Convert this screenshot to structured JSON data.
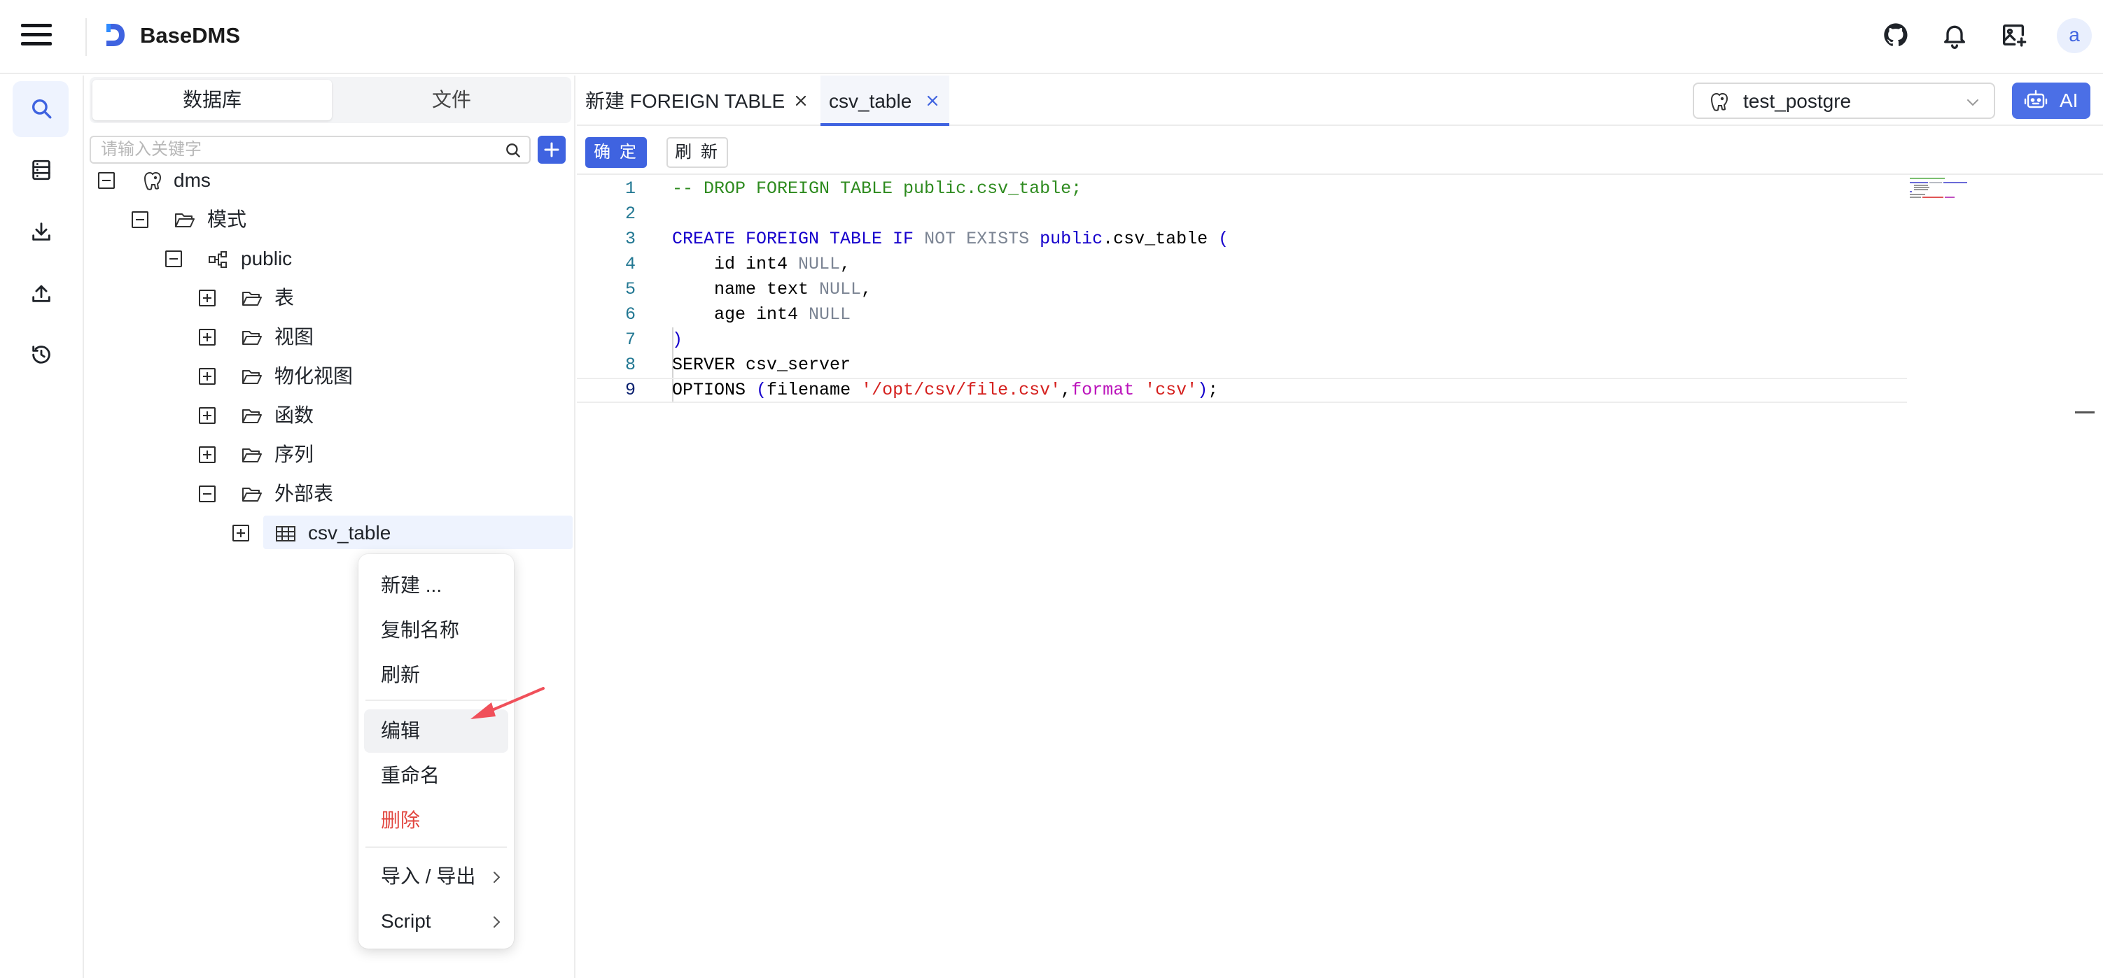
{
  "app": {
    "title": "BaseDMS",
    "avatar_letter": "a",
    "accent_color": "#3f63e0"
  },
  "topbar_icons": [
    "github-icon",
    "bell-icon",
    "image-plus-icon"
  ],
  "rail": [
    {
      "name": "search-icon",
      "active": true
    },
    {
      "name": "database-icon",
      "active": false
    },
    {
      "name": "download-icon",
      "active": false
    },
    {
      "name": "upload-icon",
      "active": false
    },
    {
      "name": "history-icon",
      "active": false
    }
  ],
  "explorer": {
    "tabs": [
      {
        "label": "数据库",
        "active": true
      },
      {
        "label": "文件",
        "active": false
      }
    ],
    "search_placeholder": "请输入关键字",
    "tree": [
      {
        "label": "dms",
        "icon": "postgres-icon",
        "expanded": true,
        "depth": 0
      },
      {
        "label": "模式",
        "icon": "folder-open-icon",
        "expanded": true,
        "depth": 1
      },
      {
        "label": "public",
        "icon": "schema-icon",
        "expanded": true,
        "depth": 2
      },
      {
        "label": "表",
        "icon": "folder-open-icon",
        "expanded": false,
        "depth": 3
      },
      {
        "label": "视图",
        "icon": "folder-open-icon",
        "expanded": false,
        "depth": 3
      },
      {
        "label": "物化视图",
        "icon": "folder-open-icon",
        "expanded": false,
        "depth": 3
      },
      {
        "label": "函数",
        "icon": "folder-open-icon",
        "expanded": false,
        "depth": 3
      },
      {
        "label": "序列",
        "icon": "folder-open-icon",
        "expanded": false,
        "depth": 3
      },
      {
        "label": "外部表",
        "icon": "folder-open-icon",
        "expanded": true,
        "depth": 3
      },
      {
        "label": "csv_table",
        "icon": "table-icon",
        "expanded": false,
        "depth": 4,
        "selected": true
      }
    ]
  },
  "editor": {
    "tabs": [
      {
        "label": "新建 FOREIGN TABLE",
        "active": false
      },
      {
        "label": "csv_table",
        "active": true
      }
    ],
    "connection": "test_postgre",
    "ai_label": "AI",
    "ok_label": "确 定",
    "refresh_label": "刷 新",
    "current_line": 9,
    "lines": [
      {
        "n": "1",
        "tokens": [
          [
            "cmt",
            "-- DROP FOREIGN TABLE public.csv_table;"
          ]
        ]
      },
      {
        "n": "2",
        "tokens": []
      },
      {
        "n": "3",
        "tokens": [
          [
            "kw",
            "CREATE FOREIGN TABLE IF"
          ],
          [
            "",
            " "
          ],
          [
            "null",
            "NOT EXISTS"
          ],
          [
            "",
            " "
          ],
          [
            "kw",
            "public"
          ],
          [
            "",
            ".csv_table "
          ],
          [
            "par",
            "("
          ]
        ]
      },
      {
        "n": "4",
        "tokens": [
          [
            "",
            "    id int4 "
          ],
          [
            "null",
            "NULL"
          ],
          [
            "",
            ","
          ]
        ]
      },
      {
        "n": "5",
        "tokens": [
          [
            "",
            "    name text "
          ],
          [
            "null",
            "NULL"
          ],
          [
            "",
            ","
          ]
        ]
      },
      {
        "n": "6",
        "tokens": [
          [
            "",
            "    age int4 "
          ],
          [
            "null",
            "NULL"
          ]
        ]
      },
      {
        "n": "7",
        "tokens": [
          [
            "par",
            ")"
          ]
        ]
      },
      {
        "n": "8",
        "tokens": [
          [
            "",
            "SERVER csv_server"
          ]
        ]
      },
      {
        "n": "9",
        "tokens": [
          [
            "",
            "OPTIONS "
          ],
          [
            "par",
            "("
          ],
          [
            "",
            "filename "
          ],
          [
            "str",
            "'/opt/csv/file.csv'"
          ],
          [
            "",
            ","
          ],
          [
            "fmt",
            "format"
          ],
          [
            "",
            " "
          ],
          [
            "str",
            "'csv'"
          ],
          [
            "par",
            ")"
          ],
          [
            "",
            ";"
          ]
        ]
      }
    ]
  },
  "context_menu": {
    "items": [
      {
        "label": "新建 ...",
        "danger": false,
        "submenu": false,
        "hover": false
      },
      {
        "label": "复制名称",
        "danger": false,
        "submenu": false,
        "hover": false
      },
      {
        "label": "刷新",
        "danger": false,
        "submenu": false,
        "hover": false
      },
      {
        "separator": true
      },
      {
        "label": "编辑",
        "danger": false,
        "submenu": false,
        "hover": true
      },
      {
        "label": "重命名",
        "danger": false,
        "submenu": false,
        "hover": false
      },
      {
        "label": "删除",
        "danger": true,
        "submenu": false,
        "hover": false
      },
      {
        "separator": true
      },
      {
        "label": "导入 / 导出",
        "danger": false,
        "submenu": true,
        "hover": false
      },
      {
        "label": "Script",
        "danger": false,
        "submenu": true,
        "hover": false
      }
    ]
  },
  "colors": {
    "accent": "#3f63e0",
    "danger": "#e1463f",
    "annotation_arrow": "#f0505a"
  }
}
